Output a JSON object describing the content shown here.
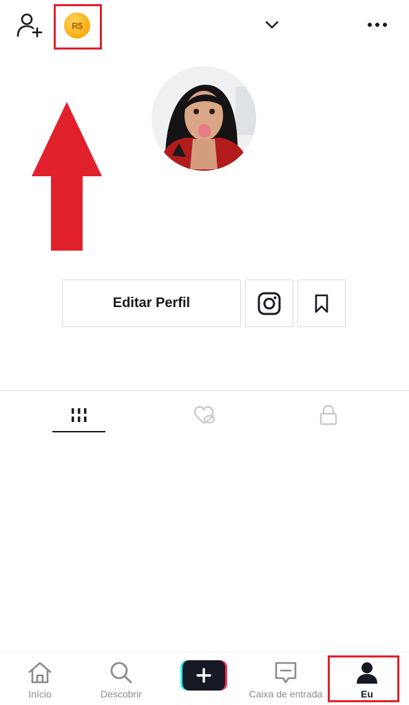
{
  "header": {
    "add_user_icon": "person-plus-icon",
    "coin": {
      "label": "R$",
      "color": "#fbb21a",
      "icon": "coin-icon"
    },
    "account_switch_icon": "chevron-down-icon",
    "more_icon": "more-horizontal-icon"
  },
  "profile": {
    "avatar_icon": "profile-photo"
  },
  "actions": {
    "edit_profile_label": "Editar Perfil",
    "instagram_icon": "instagram-icon",
    "saved_icon": "bookmark-icon"
  },
  "tabs": [
    {
      "icon": "grid-icon",
      "selected": true
    },
    {
      "icon": "liked-hidden-icon",
      "selected": false
    },
    {
      "icon": "lock-icon",
      "selected": false
    }
  ],
  "bottom_nav": {
    "items": [
      {
        "label": "Início",
        "icon": "home-icon"
      },
      {
        "label": "Descobrir",
        "icon": "search-icon"
      },
      {
        "label": "",
        "icon": "create-plus-icon"
      },
      {
        "label": "Caixa de entrada",
        "icon": "inbox-icon"
      },
      {
        "label": "Eu",
        "icon": "profile-icon",
        "selected": true
      }
    ]
  },
  "annotations": {
    "highlight_color": "#e0212b",
    "arrow_color": "#e0212b"
  }
}
